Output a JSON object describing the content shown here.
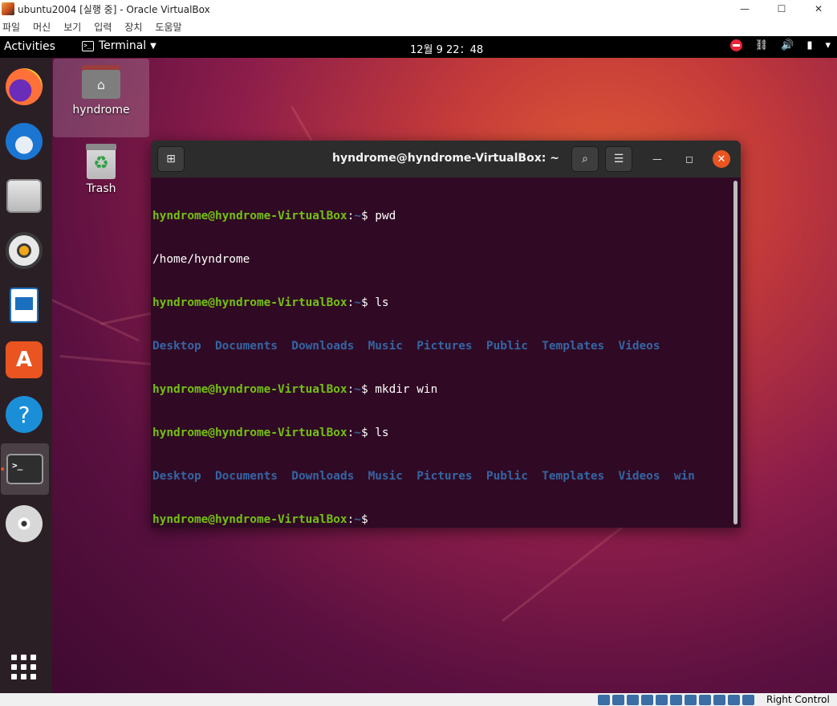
{
  "host_window": {
    "title": "ubuntu2004 [실행 중] - Oracle VirtualBox",
    "controls": {
      "minimize": "—",
      "maximize": "☐",
      "close": "✕"
    },
    "menu": [
      "파일",
      "머신",
      "보기",
      "입력",
      "장치",
      "도움말"
    ],
    "host_key_label": "Right Control"
  },
  "topbar": {
    "activities": "Activities",
    "app_menu": "Terminal",
    "clock": "12월 9  22：48",
    "tray_icons": [
      "do-not-disturb-icon",
      "network-icon",
      "volume-icon",
      "battery-icon",
      "power-menu-icon"
    ]
  },
  "dock": {
    "items": [
      "firefox",
      "thunderbird",
      "files",
      "rhythmbox",
      "libreoffice-writer",
      "ubuntu-software",
      "help",
      "terminal",
      "dvd"
    ],
    "active": "terminal"
  },
  "desktop": {
    "icons": [
      {
        "label": "hyndrome"
      },
      {
        "label": "Trash"
      }
    ]
  },
  "terminal": {
    "title": "hyndrome@hyndrome-VirtualBox: ~",
    "user_host": "hyndrome@hyndrome-VirtualBox",
    "path": "~",
    "commands": [
      "pwd",
      "ls",
      "mkdir win",
      "ls"
    ],
    "pwd_output": "/home/hyndrome",
    "ls_output_1": [
      "Desktop",
      "Documents",
      "Downloads",
      "Music",
      "Pictures",
      "Public",
      "Templates",
      "Videos"
    ],
    "ls_output_2": [
      "Desktop",
      "Documents",
      "Downloads",
      "Music",
      "Pictures",
      "Public",
      "Templates",
      "Videos",
      "win"
    ]
  },
  "colors": {
    "prompt_green": "#73c012",
    "dir_blue": "#3465a4",
    "terminal_bg": "#300a24",
    "ubuntu_orange": "#e95420"
  }
}
